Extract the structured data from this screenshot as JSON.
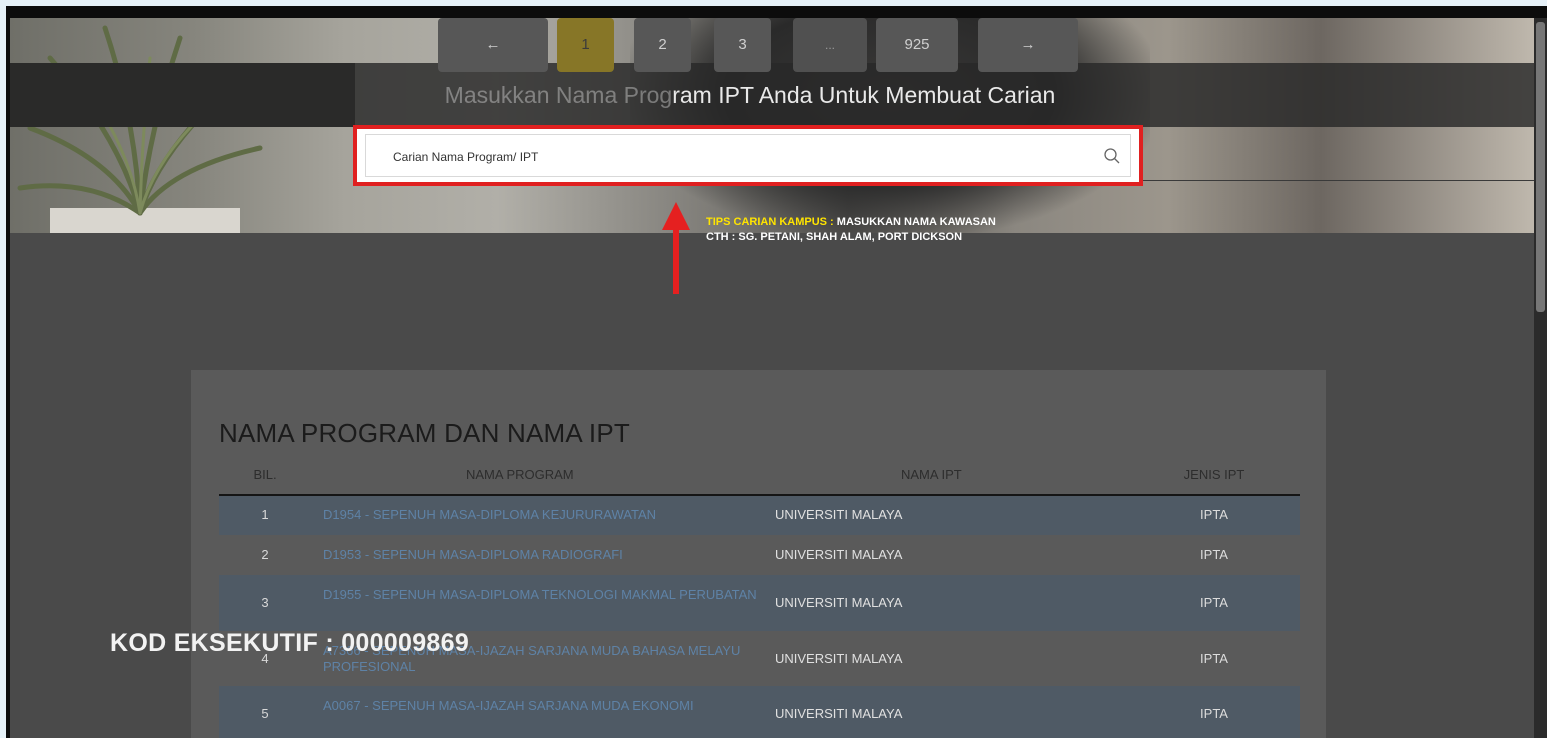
{
  "hero": {
    "title_faded": "Masukkan Nama Prog",
    "title_rest": "ram IPT Anda Untuk Membuat Carian",
    "search_placeholder": "Carian Nama Program/ IPT"
  },
  "tips": {
    "label": "TIPS CARIAN KAMPUS :",
    "line1_rest": " MASUKKAN NAMA KAWASAN",
    "line2": "CTH :  SG. PETANI, SHAH ALAM, PORT DICKSON"
  },
  "pagination": {
    "prev": "←",
    "pages": [
      "1",
      "2",
      "3"
    ],
    "ellipsis": "...",
    "last": "925",
    "next": "→",
    "active_page": "1"
  },
  "table": {
    "title": "NAMA PROGRAM DAN NAMA IPT",
    "headers": {
      "bil": "BIL.",
      "program": "NAMA PROGRAM",
      "ipt": "NAMA IPT",
      "jenis": "JENIS IPT"
    },
    "rows": [
      {
        "bil": "1",
        "program": "D1954 - SEPENUH MASA-DIPLOMA KEJURURAWATAN",
        "ipt": "UNIVERSITI MALAYA",
        "jenis": "IPTA"
      },
      {
        "bil": "2",
        "program": "D1953 - SEPENUH MASA-DIPLOMA RADIOGRAFI",
        "ipt": "UNIVERSITI MALAYA",
        "jenis": "IPTA"
      },
      {
        "bil": "3",
        "program": "D1955 - SEPENUH MASA-DIPLOMA TEKNOLOGI MAKMAL PERUBATAN",
        "ipt": "UNIVERSITI MALAYA",
        "jenis": "IPTA"
      },
      {
        "bil": "4",
        "program": "A7366 - SEPENUH MASA-IJAZAH SARJANA MUDA BAHASA MELAYU PROFESIONAL",
        "ipt": "UNIVERSITI MALAYA",
        "jenis": "IPTA"
      },
      {
        "bil": "5",
        "program": "A0067 - SEPENUH MASA-IJAZAH SARJANA MUDA EKONOMI",
        "ipt": "UNIVERSITI MALAYA",
        "jenis": "IPTA"
      }
    ]
  },
  "overlay": {
    "kod_eksekutif": "KOD EKSEKUTIF : 000009869"
  },
  "colors": {
    "highlight_red": "#e02020",
    "tips_yellow": "#ffe400",
    "active_page": "#877627"
  }
}
